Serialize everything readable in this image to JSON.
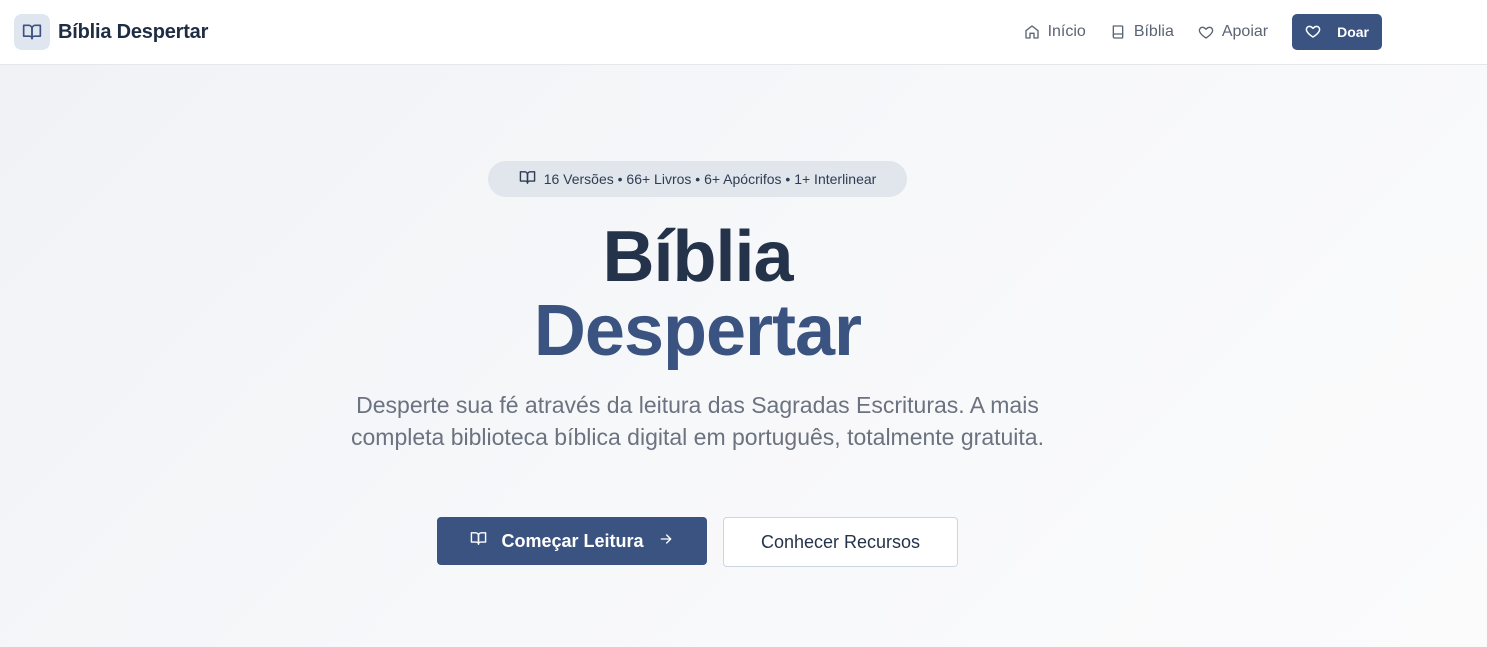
{
  "header": {
    "brand": {
      "name": "Bíblia Despertar",
      "icon": "open-book-icon"
    },
    "nav": [
      {
        "label": "Início",
        "icon": "home-icon"
      },
      {
        "label": "Bíblia",
        "icon": "book-icon"
      },
      {
        "label": "Apoiar",
        "icon": "heart-icon"
      }
    ],
    "donate_label": "Doar",
    "donate_icon": "heart-icon"
  },
  "hero": {
    "badge_text": "16 Versões • 66+ Livros • 6+ Apócrifos • 1+ Interlinear",
    "badge_icon": "open-book-icon",
    "title_line1": "Bíblia",
    "title_line2": "Despertar",
    "subtitle": "Desperte sua fé através da leitura das Sagradas Escrituras. A mais completa biblioteca bíblica digital em português, totalmente gratuita.",
    "primary_cta": "Começar Leitura",
    "secondary_cta": "Conhecer Recursos"
  },
  "colors": {
    "primary": "#3b5380",
    "dark_text": "#243349",
    "muted_text": "#6b7280",
    "badge_bg": "#e1e6ed",
    "brand_icon_bg": "#dfe6f0"
  }
}
